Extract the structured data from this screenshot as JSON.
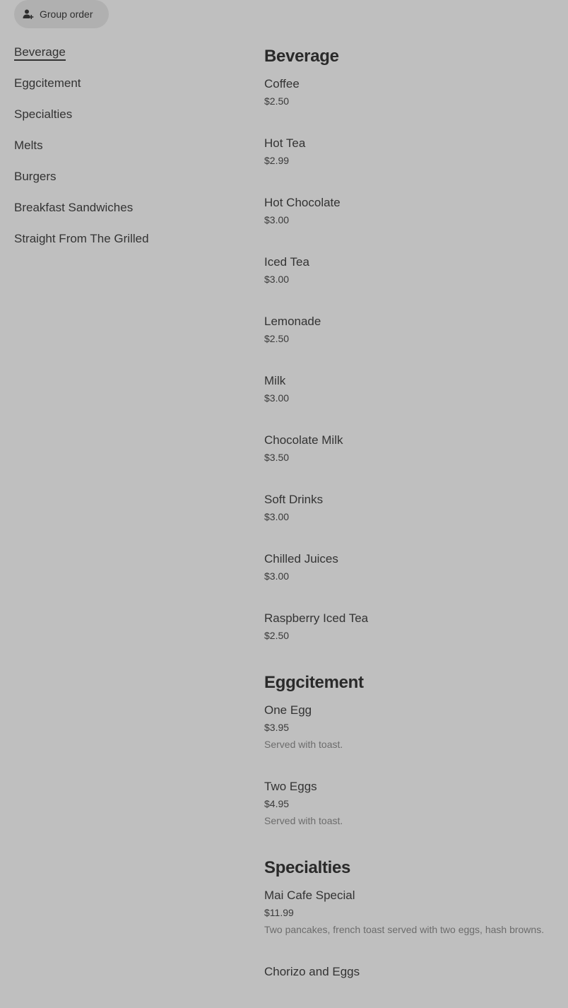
{
  "header": {
    "group_order_label": "Group order",
    "group_order_icon": "add-person-icon"
  },
  "sidebar": {
    "active_index": 0,
    "items": [
      {
        "label": "Beverage"
      },
      {
        "label": "Eggcitement"
      },
      {
        "label": "Specialties"
      },
      {
        "label": "Melts"
      },
      {
        "label": "Burgers"
      },
      {
        "label": "Breakfast Sandwiches"
      },
      {
        "label": "Straight From The Grilled"
      }
    ]
  },
  "menu": {
    "sections": [
      {
        "title": "Beverage",
        "items": [
          {
            "name": "Coffee",
            "price": "$2.50"
          },
          {
            "name": "Hot Tea",
            "price": "$2.99"
          },
          {
            "name": "Hot Chocolate",
            "price": "$3.00"
          },
          {
            "name": "Iced Tea",
            "price": "$3.00"
          },
          {
            "name": "Lemonade",
            "price": "$2.50"
          },
          {
            "name": "Milk",
            "price": "$3.00"
          },
          {
            "name": "Chocolate Milk",
            "price": "$3.50"
          },
          {
            "name": "Soft Drinks",
            "price": "$3.00"
          },
          {
            "name": "Chilled Juices",
            "price": "$3.00"
          },
          {
            "name": "Raspberry Iced Tea",
            "price": "$2.50"
          }
        ]
      },
      {
        "title": "Eggcitement",
        "items": [
          {
            "name": "One Egg",
            "price": "$3.95",
            "description": "Served with toast."
          },
          {
            "name": "Two Eggs",
            "price": "$4.95",
            "description": "Served with toast."
          }
        ]
      },
      {
        "title": "Specialties",
        "items": [
          {
            "name": "Mai Cafe Special",
            "price": "$11.99",
            "description": "Two pancakes, french toast served with two eggs, hash browns."
          },
          {
            "name": "Chorizo and Eggs",
            "price": ""
          }
        ]
      }
    ]
  },
  "colors": {
    "background": "#bfbfbf",
    "pill_background": "#b0b0b0",
    "text": "#2b2b2b",
    "muted_text": "#6c6c6c"
  }
}
